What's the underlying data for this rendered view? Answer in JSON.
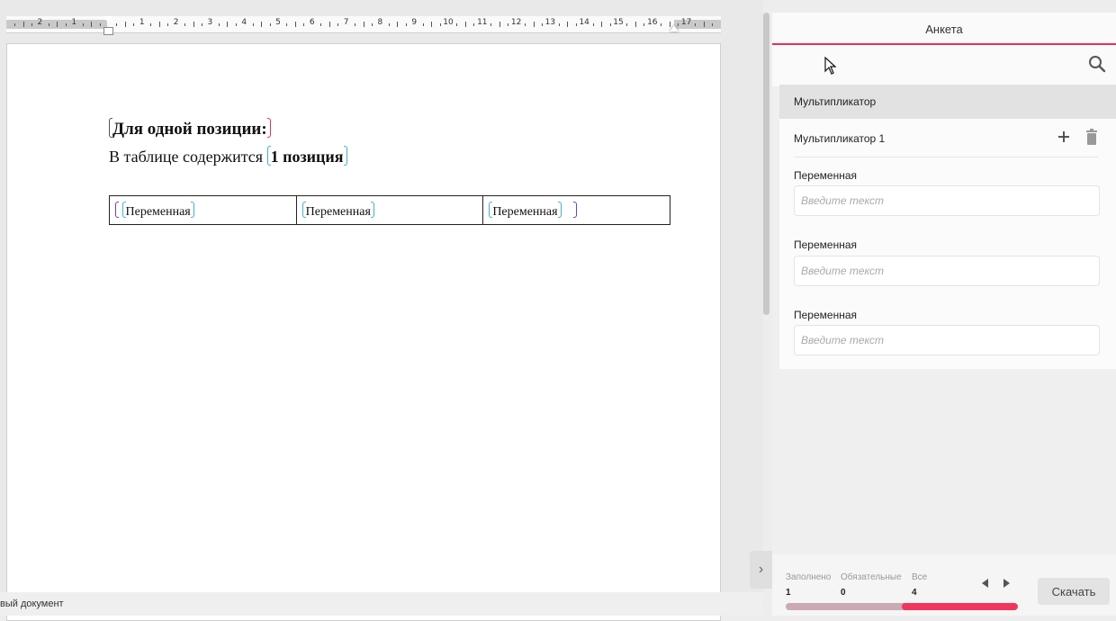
{
  "ruler": {
    "numbers": [
      "2",
      "1",
      "1",
      "2",
      "3",
      "4",
      "5",
      "6",
      "7",
      "8",
      "9",
      "10",
      "11",
      "12",
      "13",
      "14",
      "15",
      "16",
      "17"
    ]
  },
  "document": {
    "heading": "Для одной позиции:",
    "paragraph_prefix": "В таблице содержится ",
    "paragraph_bold": "1 позиция",
    "table": {
      "cells": [
        "Переменная",
        "Переменная",
        "Переменная"
      ]
    }
  },
  "statusbar": {
    "text": "вый документ"
  },
  "panel": {
    "tab": "Анкета",
    "section": "Мультипликатор",
    "multiplier_item": "Мультипликатор 1",
    "fields": [
      {
        "label": "Переменная",
        "placeholder": "Введите текст",
        "value": ""
      },
      {
        "label": "Переменная",
        "placeholder": "Введите текст",
        "value": ""
      },
      {
        "label": "Переменная",
        "placeholder": "Введите текст",
        "value": ""
      }
    ],
    "stats": {
      "filled_label": "Заполнено",
      "filled_value": "1",
      "required_label": "Обязательные",
      "required_value": "0",
      "all_label": "Все",
      "all_value": "4"
    },
    "progress": 0.5,
    "download_label": "Скачать"
  },
  "colors": {
    "accent": "#e8305a",
    "teal": "#3fb3c4",
    "violet": "#6b3fc4",
    "progress_bg": "#cbaab4"
  },
  "icons": [
    "search-icon",
    "plus-icon",
    "trash-icon",
    "chevron-right-icon",
    "cursor-icon",
    "arrow-left-icon",
    "arrow-right-icon"
  ]
}
